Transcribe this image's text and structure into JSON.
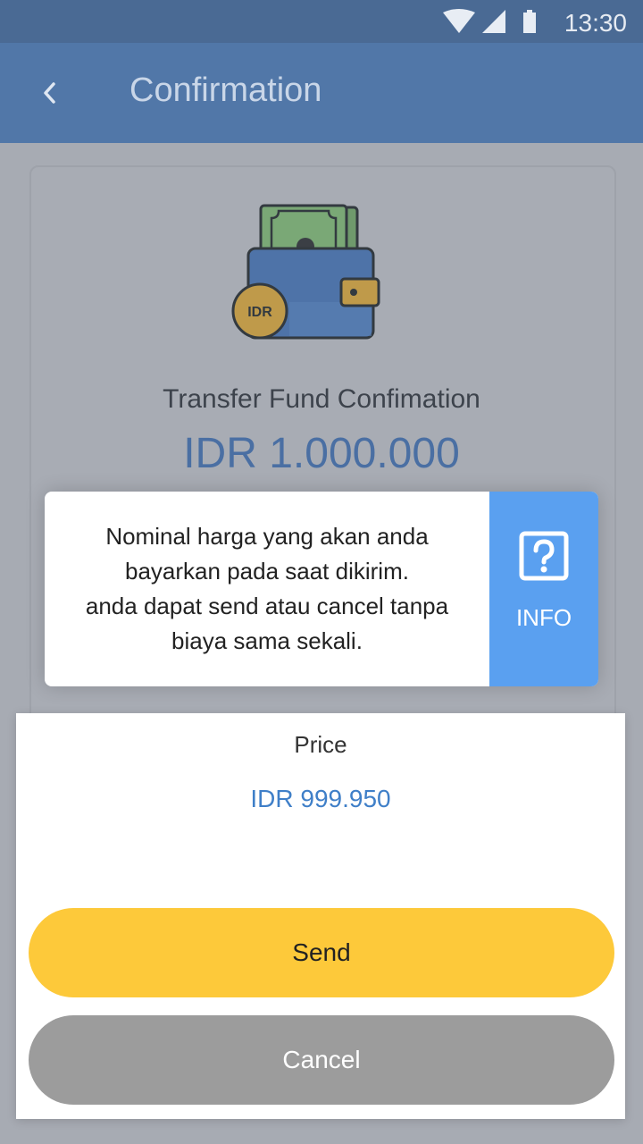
{
  "status_bar": {
    "time": "13:30",
    "icons": [
      "wifi-icon",
      "signal-icon",
      "battery-icon"
    ]
  },
  "app_bar": {
    "title": "Confirmation",
    "back_icon": "back-arrow-icon"
  },
  "transfer": {
    "illustration": "wallet-icon",
    "coin_label": "IDR",
    "title": "Transfer Fund Confimation",
    "amount": "IDR 1.000.000"
  },
  "info": {
    "message": "Nominal harga yang akan anda\nbayarkan pada saat dikirim.\nanda dapat send atau cancel tanpa\nbiaya sama sekali.",
    "button_label": "INFO",
    "button_icon": "question-icon"
  },
  "sheet": {
    "price_label": "Price",
    "price_value": "IDR 999.950",
    "send_label": "Send",
    "cancel_label": "Cancel"
  },
  "colors": {
    "app_bar": "#5177a8",
    "status_bar": "#4a6a94",
    "amount_text": "#4a6fa3",
    "info_button": "#5aa0f0",
    "send_button": "#fdc93a",
    "cancel_button": "#9c9c9c",
    "price_value": "#3f7fc8"
  }
}
